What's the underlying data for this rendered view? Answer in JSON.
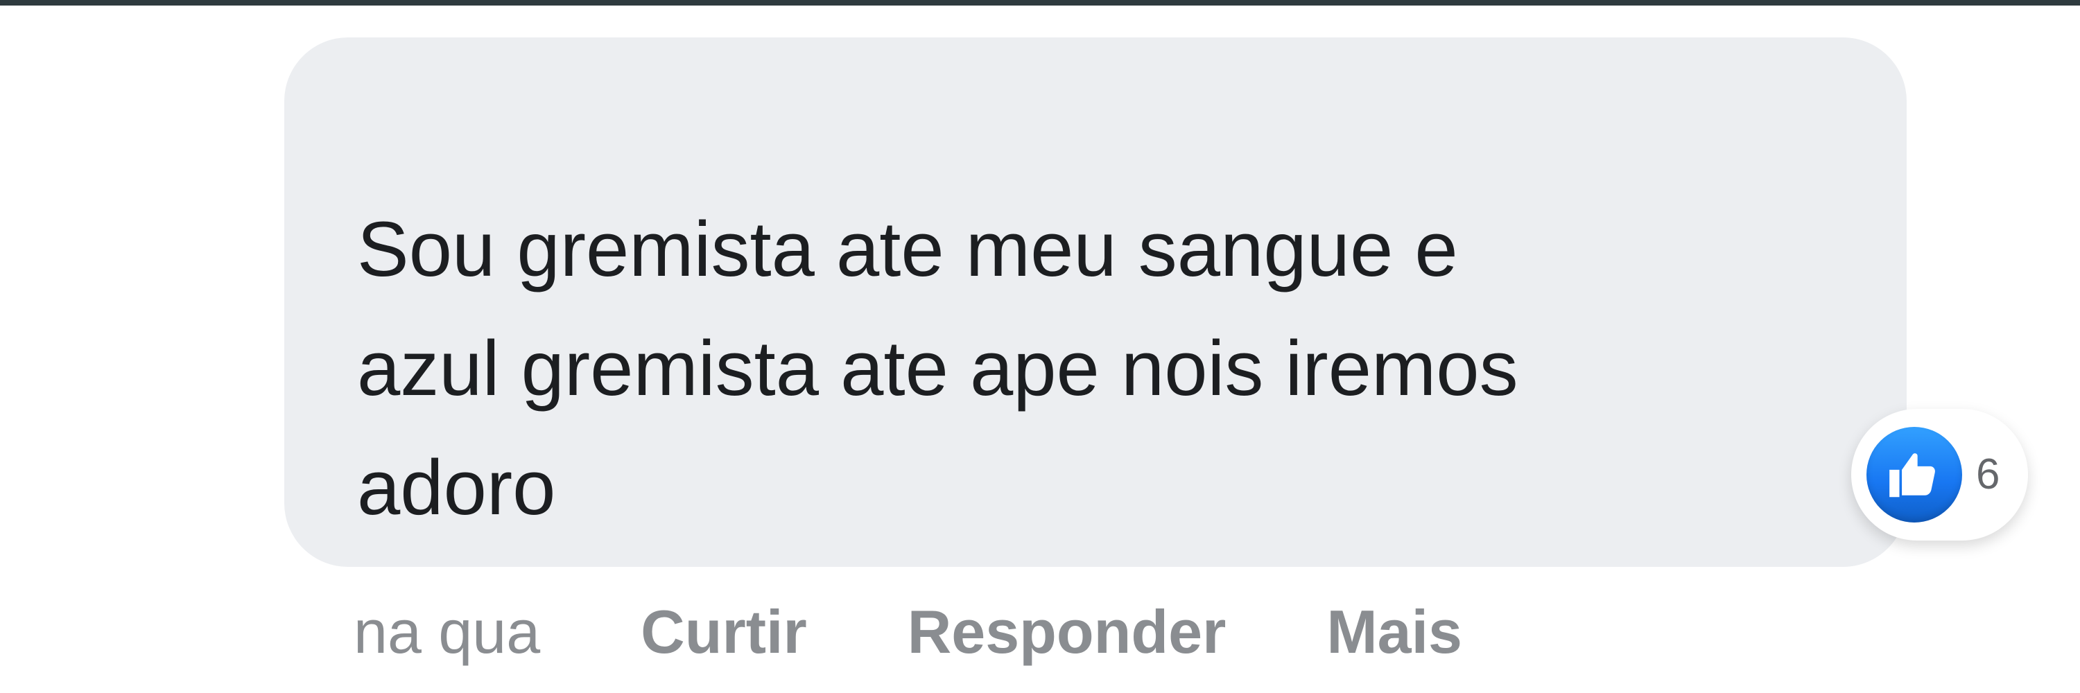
{
  "comment": {
    "text": "Sou gremista ate meu sangue e\nazul gremista ate ape nois iremos\nadoro",
    "reactions": {
      "icon": "thumbs-up-icon",
      "count": "6",
      "color": "#1877f2"
    }
  },
  "actions": {
    "timestamp": "na qua",
    "like_label": "Curtir",
    "reply_label": "Responder",
    "more_label": "Mais"
  },
  "colors": {
    "bubble": "#eceef1",
    "text": "#1c1e21",
    "secondary_text": "#8a8d91",
    "top_rule": "#2f3b3f"
  }
}
